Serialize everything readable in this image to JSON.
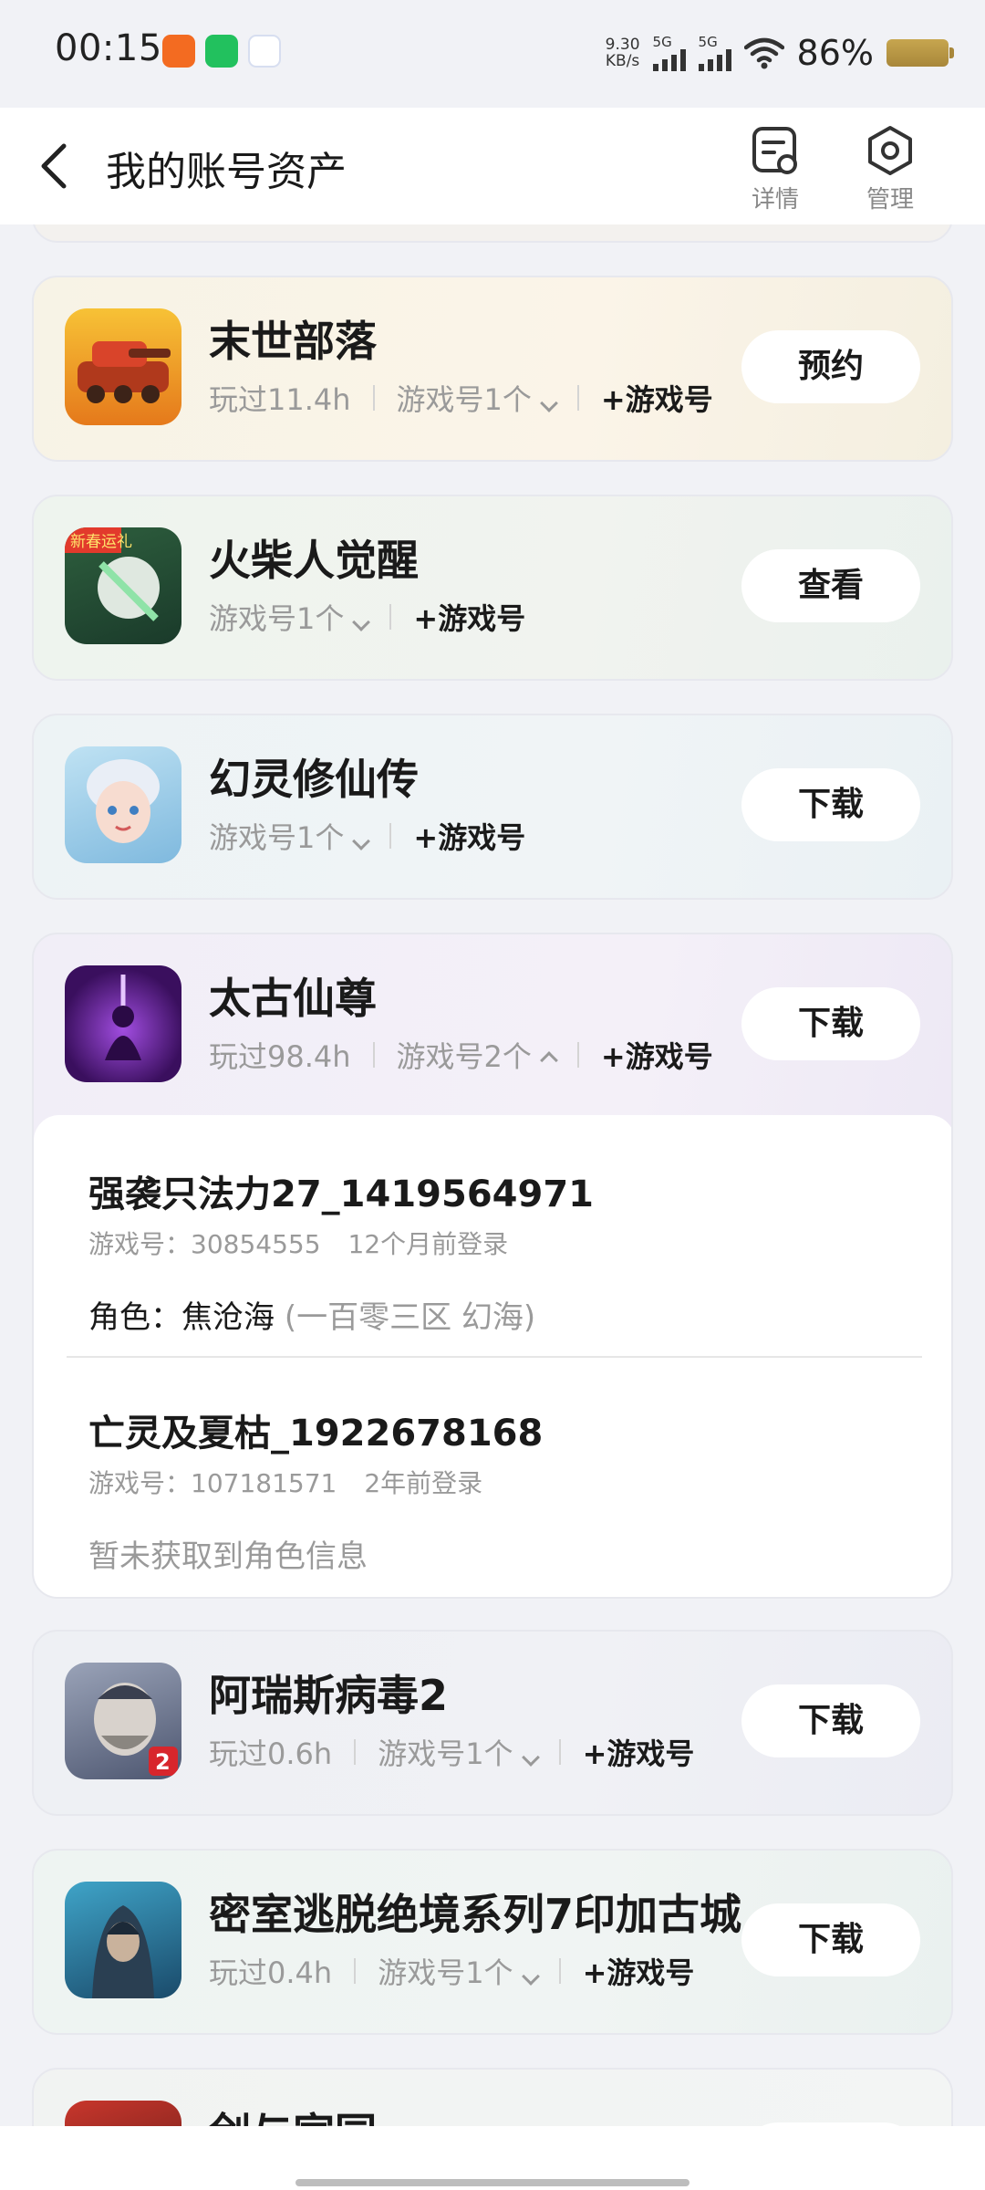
{
  "status_bar": {
    "time": "00:15",
    "net_speed": "9.30",
    "net_unit": "KB/s",
    "signal1": "5G",
    "signal2": "5G",
    "battery": "86%"
  },
  "header": {
    "title": "我的账号资产",
    "detail_label": "详情",
    "manage_label": "管理"
  },
  "games": [
    {
      "name": "末世部落",
      "played": "玩过11.4h",
      "accounts": "游戏号1个",
      "add": "+游戏号",
      "action": "预约",
      "bg": "#f7f2e4"
    },
    {
      "name": "火柴人觉醒",
      "accounts": "游戏号1个",
      "add": "+游戏号",
      "action": "查看",
      "badge": "新春运礼",
      "bg": "#edf3ef"
    },
    {
      "name": "幻灵修仙传",
      "accounts": "游戏号1个",
      "add": "+游戏号",
      "action": "下载",
      "bg": "#eef3f6"
    },
    {
      "name": "太古仙尊",
      "played": "玩过98.4h",
      "accounts": "游戏号2个",
      "add": "+游戏号",
      "action": "下载",
      "bg": "#efedf6",
      "account_list": [
        {
          "name": "强袭只法力27_1419564971",
          "id_text": "游戏号：30854555",
          "login": "12个月前登录",
          "role_label": "角色：焦沧海",
          "role_server": "(一百零三区 幻海)"
        },
        {
          "name": "亡灵及夏枯_1922678168",
          "id_text": "游戏号：107181571",
          "login": "2年前登录",
          "no_role": "暂未获取到角色信息"
        }
      ]
    },
    {
      "name": "阿瑞斯病毒2",
      "played": "玩过0.6h",
      "accounts": "游戏号1个",
      "add": "+游戏号",
      "action": "下载",
      "badge": "2",
      "bg": "#eeeff4"
    },
    {
      "name": "密室逃脱绝境系列7印加古城",
      "played": "玩过0.4h",
      "accounts": "游戏号1个",
      "add": "+游戏号",
      "action": "下载",
      "bg": "#eef3f2"
    },
    {
      "name": "剑与家园",
      "bg": "#f1f3f2"
    }
  ]
}
